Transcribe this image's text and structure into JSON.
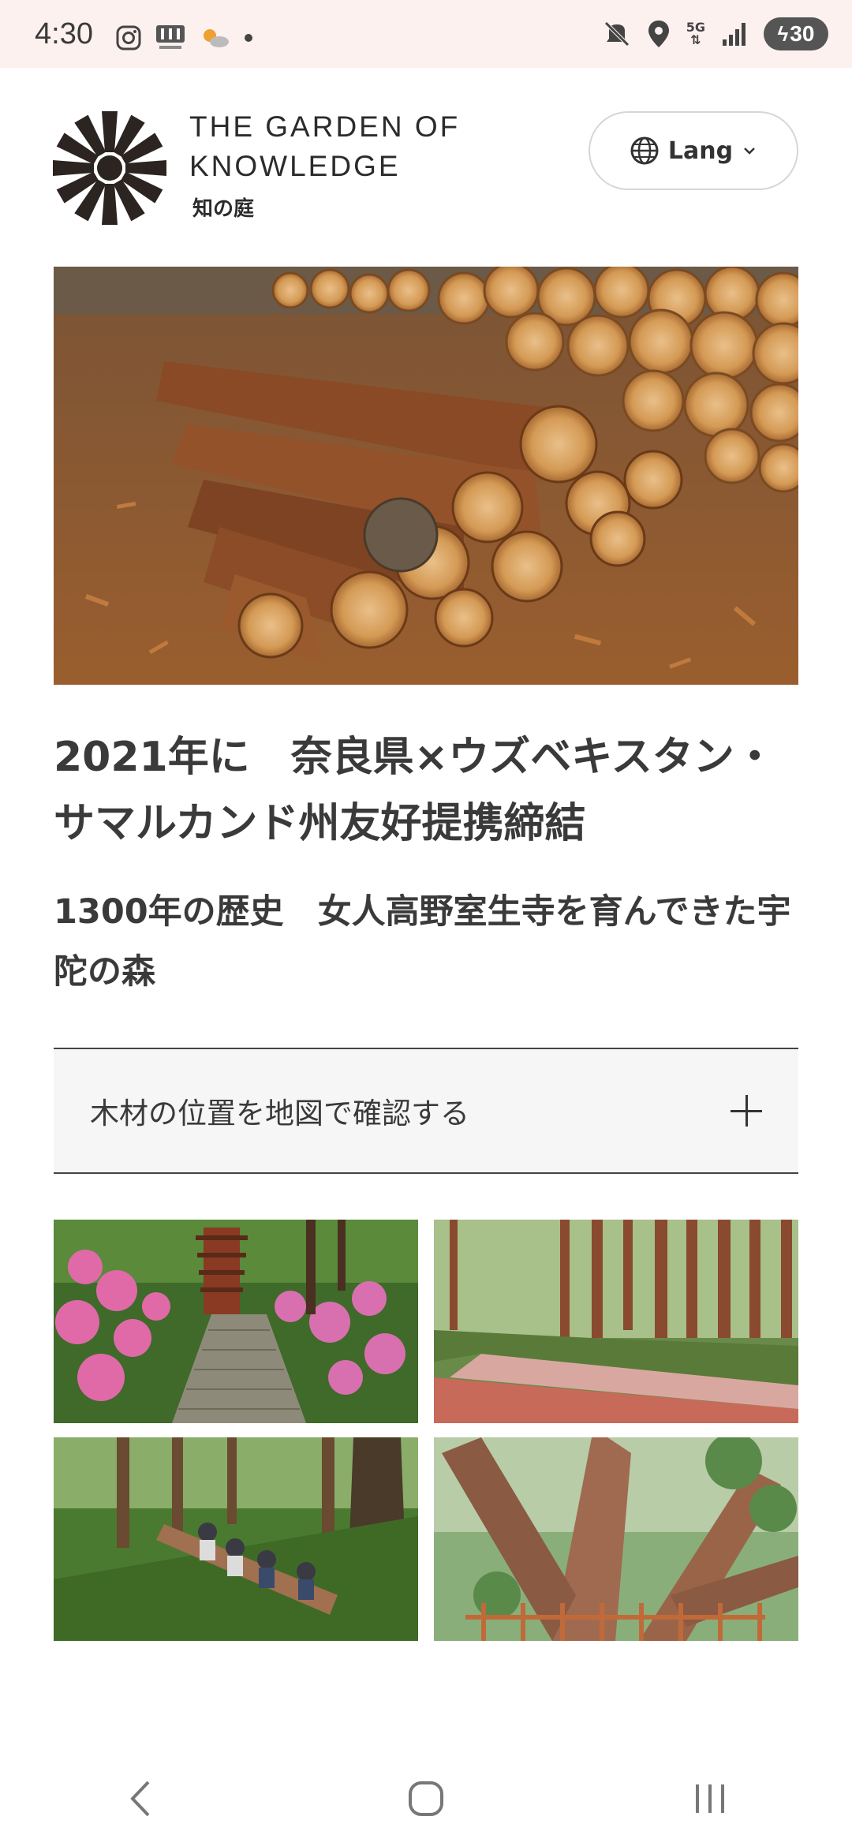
{
  "status_bar": {
    "time": "4:30",
    "battery": "30",
    "network": "5G",
    "icons": [
      "instagram-icon",
      "rakuma-icon",
      "weather-icon",
      "dot-icon",
      "mute-icon",
      "location-icon",
      "signal-icon",
      "battery-icon"
    ]
  },
  "header": {
    "brand_title": "THE GARDEN OF KNOWLEDGE",
    "brand_sub": "知の庭",
    "lang_label": "Lang"
  },
  "article": {
    "title": "2021年に　奈良県×ウズベキスタン・サマルカンド州友好提携締結",
    "subtitle": "1300年の歴史　女人高野室生寺を育んできた宇陀の森"
  },
  "accordion": {
    "label": "木材の位置を地図で確認する"
  },
  "colors": {
    "text": "#3a3a3a",
    "status_bar_bg": "#fdf1ef",
    "accordion_bg": "#f6f6f6"
  }
}
